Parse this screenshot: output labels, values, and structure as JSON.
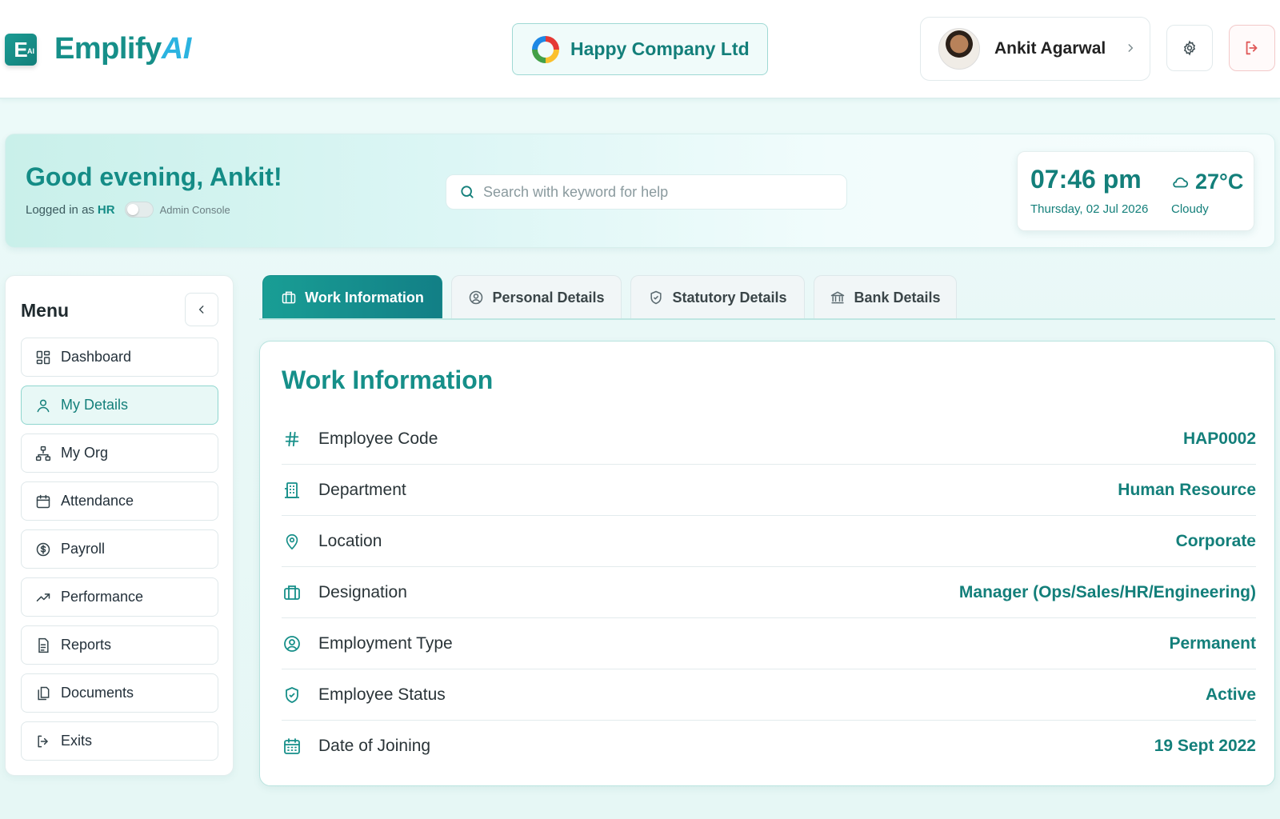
{
  "brand": {
    "badge": "E",
    "badge_sup": "AI",
    "name_main": "Emplify",
    "name_ai": "AI"
  },
  "company": {
    "name": "Happy Company Ltd"
  },
  "user": {
    "name": "Ankit Agarwal"
  },
  "banner": {
    "greeting": "Good evening, Ankit!",
    "logged_prefix": "Logged in as",
    "role": "HR",
    "admin_label": "Admin Console",
    "admin_toggle_on": false,
    "search_placeholder": "Search with keyword for help",
    "time": "07:46 pm",
    "date": "Thursday, 02 Jul 2026",
    "temperature": "27°C",
    "weather": "Cloudy"
  },
  "menu": {
    "title": "Menu",
    "items": [
      {
        "label": "Dashboard",
        "icon": "dashboard-icon",
        "active": false
      },
      {
        "label": "My Details",
        "icon": "user-icon",
        "active": true
      },
      {
        "label": "My Org",
        "icon": "org-chart-icon",
        "active": false
      },
      {
        "label": "Attendance",
        "icon": "calendar-icon",
        "active": false
      },
      {
        "label": "Payroll",
        "icon": "dollar-circle-icon",
        "active": false
      },
      {
        "label": "Performance",
        "icon": "trend-up-icon",
        "active": false
      },
      {
        "label": "Reports",
        "icon": "report-icon",
        "active": false
      },
      {
        "label": "Documents",
        "icon": "documents-icon",
        "active": false
      },
      {
        "label": "Exits",
        "icon": "exit-icon",
        "active": false
      }
    ]
  },
  "tabs": [
    {
      "label": "Work Information",
      "icon": "briefcase-icon",
      "active": true
    },
    {
      "label": "Personal Details",
      "icon": "user-circle-icon",
      "active": false
    },
    {
      "label": "Statutory Details",
      "icon": "shield-icon",
      "active": false
    },
    {
      "label": "Bank Details",
      "icon": "bank-icon",
      "active": false
    }
  ],
  "work_info": {
    "title": "Work Information",
    "rows": [
      {
        "label": "Employee Code",
        "value": "HAP0002",
        "icon": "hash-icon"
      },
      {
        "label": "Department",
        "value": "Human Resource",
        "icon": "building-icon"
      },
      {
        "label": "Location",
        "value": "Corporate",
        "icon": "location-pin-icon"
      },
      {
        "label": "Designation",
        "value": "Manager (Ops/Sales/HR/Engineering)",
        "icon": "briefcase-icon"
      },
      {
        "label": "Employment Type",
        "value": "Permanent",
        "icon": "user-circle-icon"
      },
      {
        "label": "Employee Status",
        "value": "Active",
        "icon": "shield-check-icon"
      },
      {
        "label": "Date of Joining",
        "value": "19 Sept 2022",
        "icon": "calendar-grid-icon"
      }
    ]
  },
  "colors": {
    "primary": "#168f89",
    "accent": "#2bb3e0",
    "logout": "#e05a5a"
  }
}
